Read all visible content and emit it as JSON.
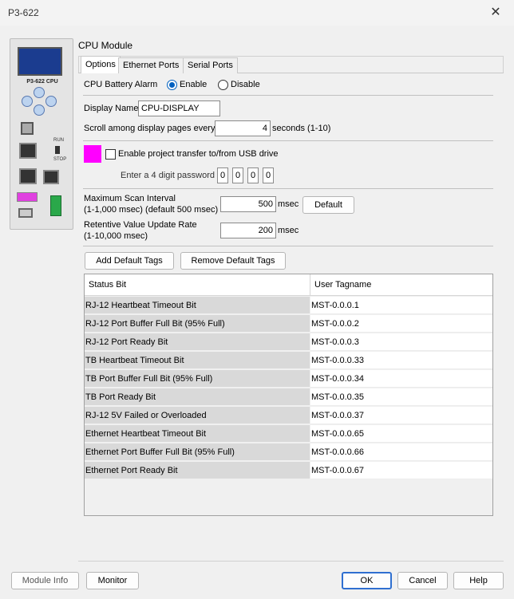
{
  "window": {
    "title": "P3-622"
  },
  "device": {
    "model_label": "P3-622 CPU",
    "run_label": "RUN",
    "stop_label": "STOP"
  },
  "panel": {
    "title": "CPU Module"
  },
  "tabs": [
    {
      "label": "Options",
      "active": true
    },
    {
      "label": "Ethernet Ports",
      "active": false
    },
    {
      "label": "Serial Ports",
      "active": false
    }
  ],
  "battery_alarm": {
    "label": "CPU Battery Alarm",
    "enable_label": "Enable",
    "disable_label": "Disable",
    "selected": "Enable"
  },
  "display_name": {
    "label": "Display Name",
    "value": "CPU-DISPLAY"
  },
  "scroll": {
    "label": "Scroll among display pages every",
    "value": "4",
    "suffix": "seconds (1-10)"
  },
  "usb_transfer": {
    "checkbox_label": "Enable project transfer to/from USB drive",
    "checked": false,
    "password_label": "Enter a 4 digit password",
    "password_digits": [
      "0",
      "0",
      "0",
      "0"
    ],
    "color": "#ff00ff"
  },
  "scan_interval": {
    "label_line1": "Maximum Scan Interval",
    "label_line2": "(1-1,000 msec) (default 500 msec)",
    "value": "500",
    "unit": "msec",
    "default_button": "Default"
  },
  "retentive": {
    "label_line1": "Retentive Value Update Rate",
    "label_line2": "(1-10,000 msec)",
    "value": "200",
    "unit": "msec"
  },
  "tag_buttons": {
    "add": "Add Default Tags",
    "remove": "Remove Default Tags"
  },
  "table": {
    "columns": [
      "Status Bit",
      "User Tagname"
    ],
    "rows": [
      [
        "RJ-12 Heartbeat Timeout Bit",
        "MST-0.0.0.1"
      ],
      [
        "RJ-12 Port Buffer Full Bit (95% Full)",
        "MST-0.0.0.2"
      ],
      [
        "RJ-12 Port Ready Bit",
        "MST-0.0.0.3"
      ],
      [
        "TB Heartbeat Timeout Bit",
        "MST-0.0.0.33"
      ],
      [
        "TB Port Buffer Full Bit (95% Full)",
        "MST-0.0.0.34"
      ],
      [
        "TB Port Ready Bit",
        "MST-0.0.0.35"
      ],
      [
        "RJ-12 5V Failed or Overloaded",
        "MST-0.0.0.37"
      ],
      [
        "Ethernet Heartbeat Timeout Bit",
        "MST-0.0.0.65"
      ],
      [
        "Ethernet Port Buffer Full Bit (95% Full)",
        "MST-0.0.0.66"
      ],
      [
        "Ethernet Port Ready Bit",
        "MST-0.0.0.67"
      ]
    ]
  },
  "footer": {
    "module_info": "Module Info",
    "monitor": "Monitor",
    "ok": "OK",
    "cancel": "Cancel",
    "help": "Help"
  }
}
